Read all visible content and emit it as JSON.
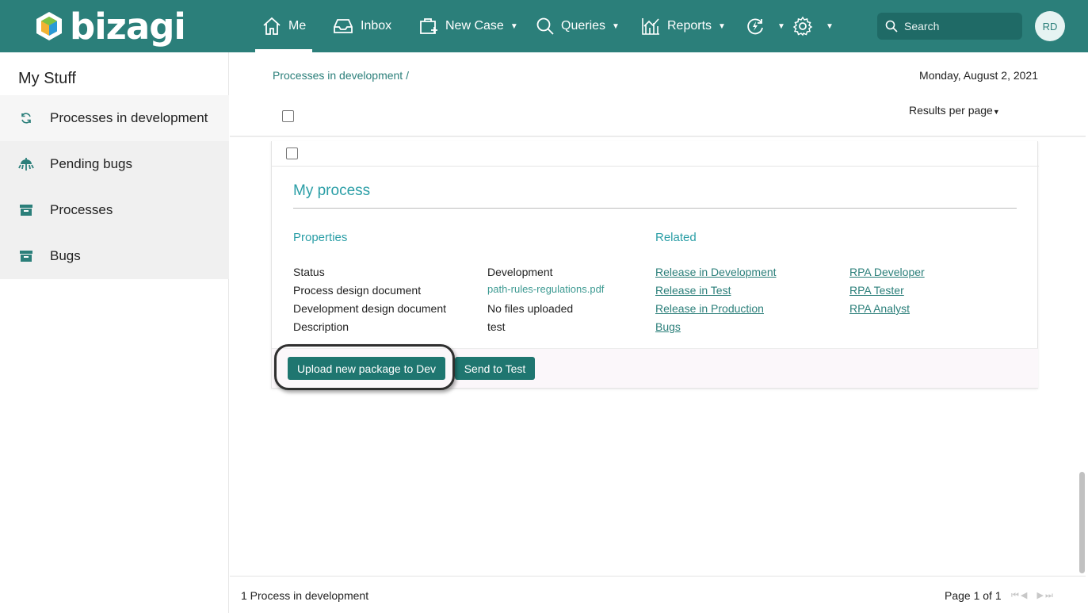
{
  "header": {
    "brand": "bizagi",
    "nav": [
      {
        "label": "Me",
        "icon": "home-icon",
        "active": true
      },
      {
        "label": "Inbox",
        "icon": "inbox-icon"
      },
      {
        "label": "New Case",
        "icon": "new-case-icon"
      },
      {
        "label": "Queries",
        "icon": "search-icon"
      },
      {
        "label": "Reports",
        "icon": "reports-icon"
      }
    ],
    "search_placeholder": "Search",
    "avatar_initials": "RD"
  },
  "sidebar": {
    "title": "My Stuff",
    "items": [
      {
        "label": "Processes in development",
        "icon": "refresh-icon",
        "active": true
      },
      {
        "label": "Pending bugs",
        "icon": "bug-icon"
      },
      {
        "label": "Processes",
        "icon": "archive-icon"
      },
      {
        "label": "Bugs",
        "icon": "archive-icon"
      }
    ]
  },
  "main": {
    "breadcrumb": "Processes in development /",
    "date": "Monday, August 2, 2021",
    "results_per_page": "Results per page",
    "process": {
      "title": "My process",
      "properties_heading": "Properties",
      "related_heading": "Related",
      "properties": [
        {
          "label": "Status",
          "value": "Development"
        },
        {
          "label": "Process design document",
          "value": "path-rules-regulations.pdf"
        },
        {
          "label": "Development design document",
          "value": "No files uploaded"
        },
        {
          "label": "Description",
          "value": "test"
        }
      ],
      "related_col1": [
        "Release in Development",
        "Release in Test",
        "Release in Production",
        "Bugs"
      ],
      "related_col2": [
        "RPA Developer",
        "RPA Tester",
        "RPA Analyst"
      ],
      "buttons": {
        "upload": "Upload new package to Dev",
        "send": "Send to Test"
      }
    },
    "footer": {
      "count": "1 Process in development",
      "page": "Page 1 of 1"
    }
  },
  "colors": {
    "brand": "#2b7f7a",
    "accent": "#2a9ea6",
    "button": "#1f7670"
  }
}
